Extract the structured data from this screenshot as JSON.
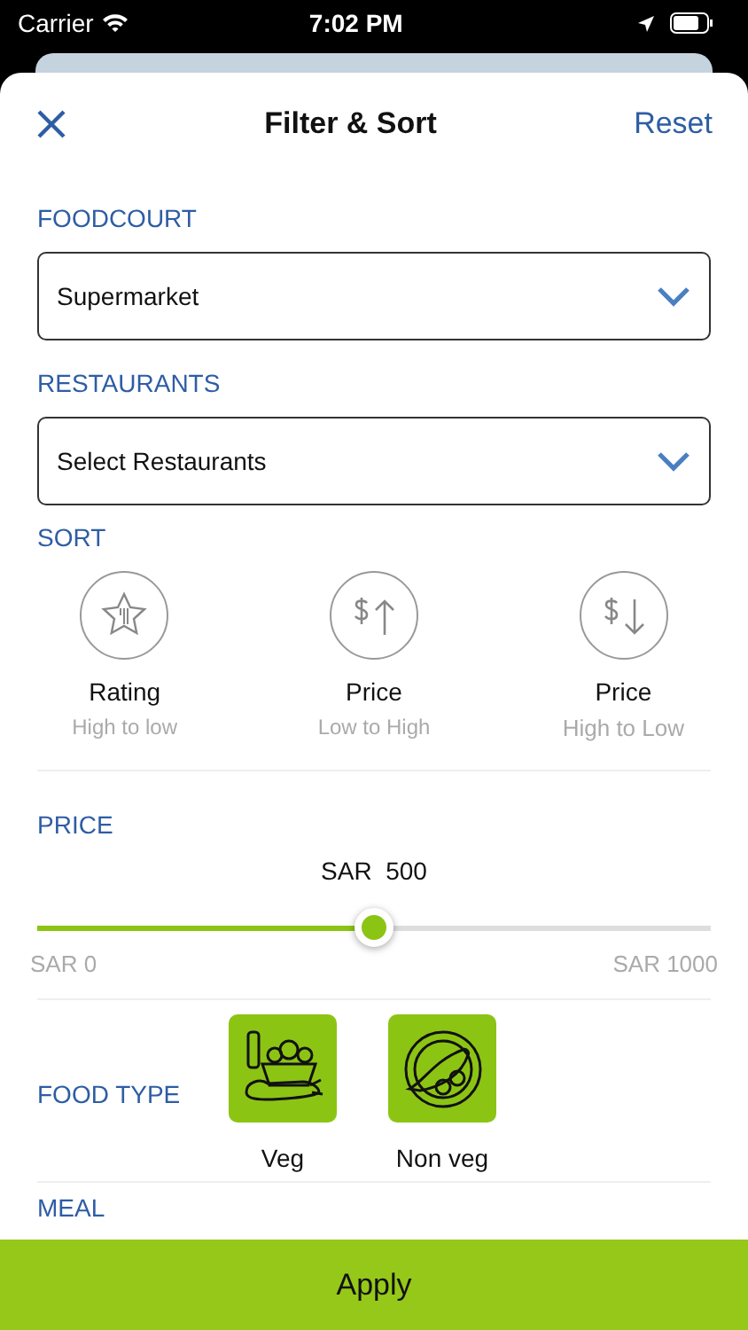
{
  "status_bar": {
    "carrier": "Carrier",
    "time": "7:02 PM"
  },
  "header": {
    "title": "Filter & Sort",
    "reset": "Reset"
  },
  "foodcourt": {
    "label": "FOODCOURT",
    "value": "Supermarket"
  },
  "restaurants": {
    "label": "RESTAURANTS",
    "placeholder": "Select Restaurants"
  },
  "sort": {
    "label": "SORT",
    "options": [
      {
        "kind": "rating",
        "title": "Rating",
        "subtitle": "High to low",
        "selected": false
      },
      {
        "kind": "price-up",
        "title": "Price",
        "subtitle": "Low to High",
        "selected": false
      },
      {
        "kind": "price-down",
        "title": "Price",
        "subtitle": "High to Low",
        "selected": false
      }
    ]
  },
  "price": {
    "label": "PRICE",
    "reading": "SAR  500",
    "level": 0.5,
    "min": "SAR 0",
    "max": "SAR 1000"
  },
  "food_type": {
    "label": "FOOD TYPE",
    "options": [
      {
        "kind": "veg",
        "label": "Veg"
      },
      {
        "kind": "nonveg",
        "label": "Non veg"
      }
    ]
  },
  "meal": {
    "label": "MEAL"
  },
  "apply": "Apply"
}
